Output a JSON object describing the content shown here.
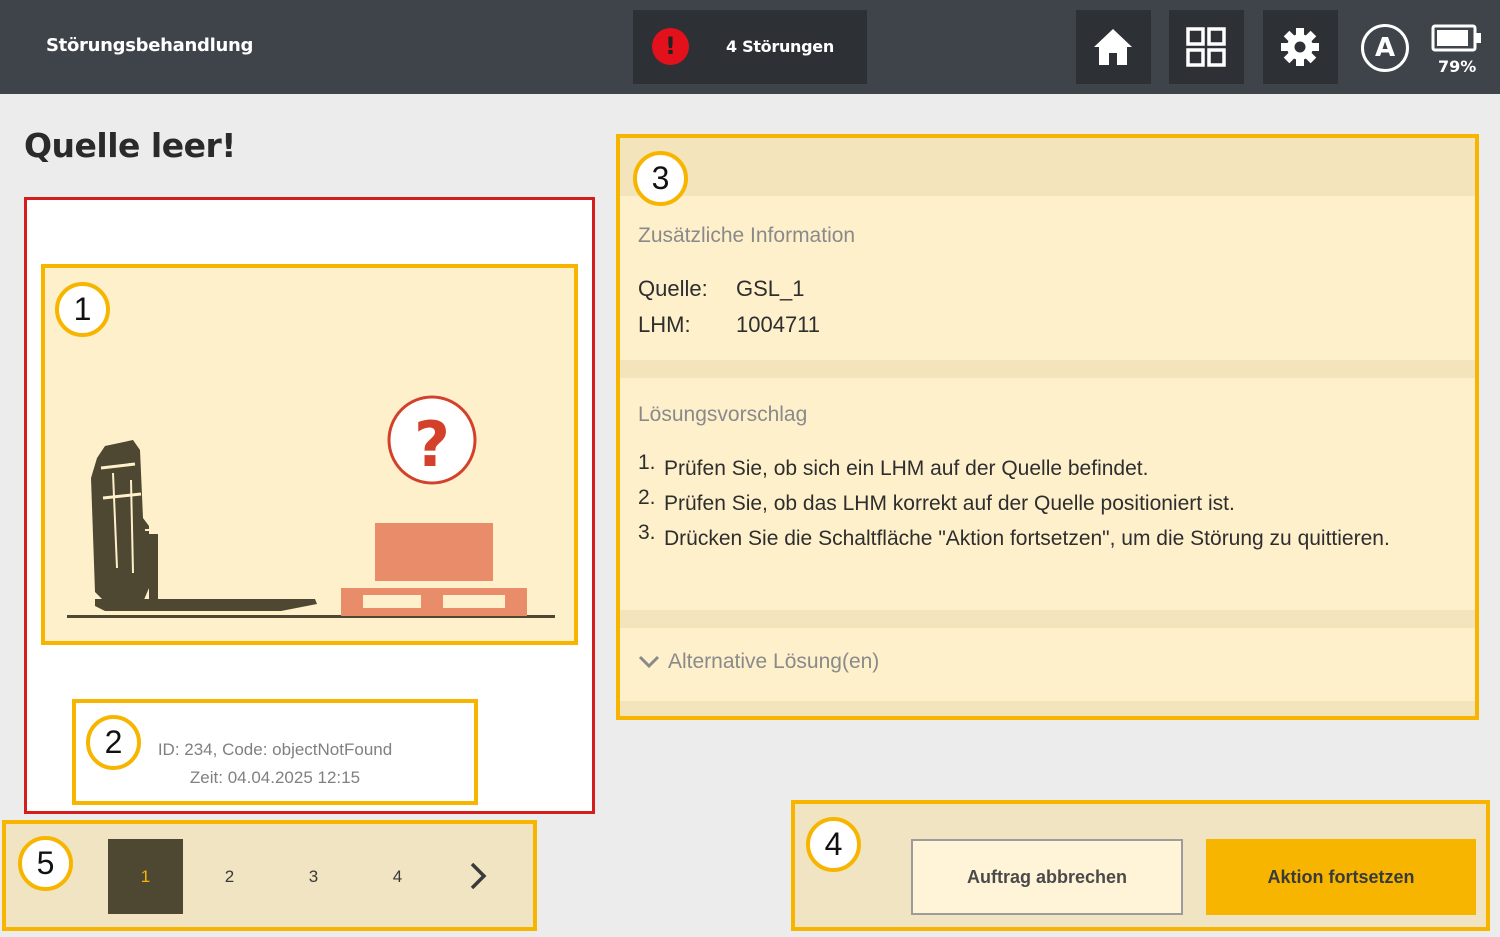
{
  "header": {
    "title": "Störungsbehandlung",
    "alarm_icon": "!",
    "alarm_text": "4 Störungen",
    "icons": [
      "home-icon",
      "grid-icon",
      "gear-icon",
      "auto-mode-icon",
      "battery-icon"
    ],
    "auto_label": "A",
    "battery": "79%"
  },
  "page": {
    "title": "Quelle leer!"
  },
  "error_meta": {
    "id_line": "ID: 234, Code: objectNotFound",
    "time_line": "Zeit: 04.04.2025 12:15"
  },
  "info": {
    "additional_title": "Zusätzliche Information",
    "source_label": "Quelle:",
    "source_value": "GSL_1",
    "lhm_label": "LHM:",
    "lhm_value": "1004711",
    "solution_title": "Lösungsvorschlag",
    "steps": [
      {
        "num": "1.",
        "text": "Prüfen Sie, ob sich ein LHM auf der Quelle befindet."
      },
      {
        "num": "2.",
        "text": "Prüfen Sie, ob das LHM korrekt auf der Quelle positioniert ist."
      },
      {
        "num": "3.",
        "text": "Drücken Sie die Schaltfläche \"Aktion fortsetzen\", um die Störung zu quittieren."
      }
    ],
    "alternative_label": "Alternative Lösung(en)"
  },
  "pager": {
    "pages": [
      "1",
      "2",
      "3",
      "4"
    ],
    "active": "1",
    "next_icon": "chevron-right-icon"
  },
  "actions": {
    "cancel_label": "Auftrag abbrechen",
    "continue_label": "Aktion fortsetzen"
  },
  "callouts": [
    "1",
    "2",
    "3",
    "4",
    "5"
  ],
  "colors": {
    "topbar": "#3e4449",
    "accent": "#f7b500",
    "alarm": "#e3111b",
    "error_border": "#d41d1d",
    "panel": "#fff0cc",
    "illustration_dark": "#4e4832",
    "illustration_salmon": "#e88c6a"
  }
}
